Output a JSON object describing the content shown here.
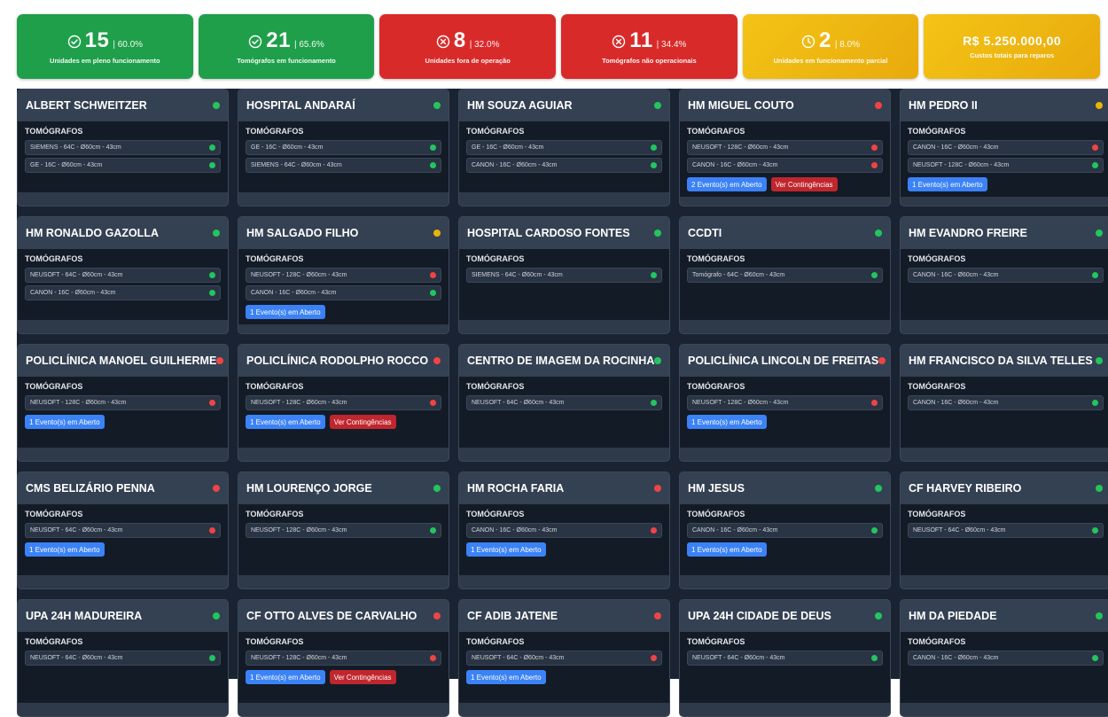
{
  "stats": [
    {
      "icon": "check-circle-icon",
      "value": "15",
      "pct": "| 60.0%",
      "label": "Unidades em pleno funcionamento",
      "color": "green"
    },
    {
      "icon": "check-circle-icon",
      "value": "21",
      "pct": "| 65.6%",
      "label": "Tomógrafos em funcionamento",
      "color": "green"
    },
    {
      "icon": "x-circle-icon",
      "value": "8",
      "pct": "| 32.0%",
      "label": "Unidades fora de operação",
      "color": "red"
    },
    {
      "icon": "x-circle-icon",
      "value": "11",
      "pct": "| 34.4%",
      "label": "Tomógrafos não operacionais",
      "color": "red"
    },
    {
      "icon": "clock-icon",
      "value": "2",
      "pct": "| 8.0%",
      "label": "Unidades em funcionamento parcial",
      "color": "yellow"
    },
    {
      "icon": "",
      "value": "R$ 5.250.000,00",
      "pct": "",
      "label": "Custos totais para reparos",
      "color": "yellow"
    }
  ],
  "section_label": "TOMÓGRAFOS",
  "status_colors": {
    "green": "#22c55e",
    "red": "#ef4444",
    "yellow": "#eab308"
  },
  "units": [
    {
      "name": "ALBERT SCHWEITZER",
      "status": "green",
      "devices": [
        {
          "name": "SIEMENS - 64C - Ø60cm - 43cm",
          "status": "green"
        },
        {
          "name": "GE - 16C - Ø60cm - 43cm",
          "status": "green"
        }
      ],
      "buttons": []
    },
    {
      "name": "HOSPITAL ANDARAÍ",
      "status": "green",
      "devices": [
        {
          "name": "GE - 16C - Ø60cm - 43cm",
          "status": "green"
        },
        {
          "name": "SIEMENS - 64C - Ø60cm - 43cm",
          "status": "green"
        }
      ],
      "buttons": []
    },
    {
      "name": "HM SOUZA AGUIAR",
      "status": "green",
      "devices": [
        {
          "name": "GE - 16C - Ø60cm - 43cm",
          "status": "green"
        },
        {
          "name": "CANON - 16C - Ø60cm - 43cm",
          "status": "green"
        }
      ],
      "buttons": []
    },
    {
      "name": "HM MIGUEL COUTO",
      "status": "red",
      "devices": [
        {
          "name": "NEUSOFT - 128C - Ø60cm - 43cm",
          "status": "red"
        },
        {
          "name": "CANON - 16C - Ø60cm - 43cm",
          "status": "red"
        }
      ],
      "buttons": [
        {
          "label": "2 Evento(s) em Aberto",
          "kind": "blue"
        },
        {
          "label": "Ver Contingências",
          "kind": "red"
        }
      ]
    },
    {
      "name": "HM PEDRO II",
      "status": "yellow",
      "devices": [
        {
          "name": "CANON - 16C - Ø60cm - 43cm",
          "status": "red"
        },
        {
          "name": "NEUSOFT - 128C - Ø60cm - 43cm",
          "status": "green"
        }
      ],
      "buttons": [
        {
          "label": "1 Evento(s) em Aberto",
          "kind": "blue"
        }
      ]
    },
    {
      "name": "HM RONALDO GAZOLLA",
      "status": "green",
      "devices": [
        {
          "name": "NEUSOFT - 64C - Ø60cm - 43cm",
          "status": "green"
        },
        {
          "name": "CANON - 16C - Ø60cm - 43cm",
          "status": "green"
        }
      ],
      "buttons": []
    },
    {
      "name": "HM SALGADO FILHO",
      "status": "yellow",
      "devices": [
        {
          "name": "NEUSOFT - 128C - Ø60cm - 43cm",
          "status": "red"
        },
        {
          "name": "CANON - 16C - Ø60cm - 43cm",
          "status": "green"
        }
      ],
      "buttons": [
        {
          "label": "1 Evento(s) em Aberto",
          "kind": "blue"
        }
      ]
    },
    {
      "name": "HOSPITAL CARDOSO FONTES",
      "status": "green",
      "devices": [
        {
          "name": "SIEMENS - 64C - Ø60cm - 43cm",
          "status": "green"
        }
      ],
      "buttons": []
    },
    {
      "name": "CCDTI",
      "status": "green",
      "devices": [
        {
          "name": "Tomógrafo - 64C - Ø60cm - 43cm",
          "status": "green"
        }
      ],
      "buttons": []
    },
    {
      "name": "HM EVANDRO FREIRE",
      "status": "green",
      "devices": [
        {
          "name": "CANON - 16C - Ø60cm - 43cm",
          "status": "green"
        }
      ],
      "buttons": []
    },
    {
      "name": "POLICLÍNICA MANOEL GUILHERME",
      "status": "red",
      "devices": [
        {
          "name": "NEUSOFT - 128C - Ø60cm - 43cm",
          "status": "red"
        }
      ],
      "buttons": [
        {
          "label": "1 Evento(s) em Aberto",
          "kind": "blue"
        }
      ]
    },
    {
      "name": "POLICLÍNICA RODOLPHO ROCCO",
      "status": "red",
      "devices": [
        {
          "name": "NEUSOFT - 128C - Ø60cm - 43cm",
          "status": "red"
        }
      ],
      "buttons": [
        {
          "label": "1 Evento(s) em Aberto",
          "kind": "blue"
        },
        {
          "label": "Ver Contingências",
          "kind": "red"
        }
      ]
    },
    {
      "name": "CENTRO DE IMAGEM DA ROCINHA",
      "status": "green",
      "devices": [
        {
          "name": "NEUSOFT - 64C - Ø60cm - 43cm",
          "status": "green"
        }
      ],
      "buttons": []
    },
    {
      "name": "POLICLÍNICA LINCOLN DE FREITAS",
      "status": "red",
      "devices": [
        {
          "name": "NEUSOFT - 128C - Ø60cm - 43cm",
          "status": "red"
        }
      ],
      "buttons": [
        {
          "label": "1 Evento(s) em Aberto",
          "kind": "blue"
        }
      ]
    },
    {
      "name": "HM FRANCISCO DA SILVA TELLES",
      "status": "green",
      "devices": [
        {
          "name": "CANON - 16C - Ø60cm - 43cm",
          "status": "green"
        }
      ],
      "buttons": []
    },
    {
      "name": "CMS BELIZÁRIO PENNA",
      "status": "red",
      "devices": [
        {
          "name": "NEUSOFT - 64C - Ø60cm - 43cm",
          "status": "red"
        }
      ],
      "buttons": [
        {
          "label": "1 Evento(s) em Aberto",
          "kind": "blue"
        }
      ]
    },
    {
      "name": "HM LOURENÇO JORGE",
      "status": "green",
      "devices": [
        {
          "name": "NEUSOFT - 128C - Ø60cm - 43cm",
          "status": "green"
        }
      ],
      "buttons": []
    },
    {
      "name": "HM ROCHA FARIA",
      "status": "red",
      "devices": [
        {
          "name": "CANON - 16C - Ø60cm - 43cm",
          "status": "red"
        }
      ],
      "buttons": [
        {
          "label": "1 Evento(s) em Aberto",
          "kind": "blue"
        }
      ]
    },
    {
      "name": "HM JESUS",
      "status": "green",
      "devices": [
        {
          "name": "CANON - 16C - Ø60cm - 43cm",
          "status": "green"
        }
      ],
      "buttons": [
        {
          "label": "1 Evento(s) em Aberto",
          "kind": "blue"
        }
      ]
    },
    {
      "name": "CF HARVEY RIBEIRO",
      "status": "green",
      "devices": [
        {
          "name": "NEUSOFT - 64C - Ø60cm - 43cm",
          "status": "green"
        }
      ],
      "buttons": []
    },
    {
      "name": "UPA 24H MADUREIRA",
      "status": "green",
      "devices": [
        {
          "name": "NEUSOFT - 64C - Ø60cm - 43cm",
          "status": "green"
        }
      ],
      "buttons": []
    },
    {
      "name": "CF OTTO ALVES DE CARVALHO",
      "status": "red",
      "devices": [
        {
          "name": "NEUSOFT - 128C - Ø60cm - 43cm",
          "status": "red"
        }
      ],
      "buttons": [
        {
          "label": "1 Evento(s) em Aberto",
          "kind": "blue"
        },
        {
          "label": "Ver Contingências",
          "kind": "red"
        }
      ]
    },
    {
      "name": "CF ADIB JATENE",
      "status": "red",
      "devices": [
        {
          "name": "NEUSOFT - 64C - Ø60cm - 43cm",
          "status": "red"
        }
      ],
      "buttons": [
        {
          "label": "1 Evento(s) em Aberto",
          "kind": "blue"
        }
      ]
    },
    {
      "name": "UPA 24H CIDADE DE DEUS",
      "status": "green",
      "devices": [
        {
          "name": "NEUSOFT - 64C - Ø60cm - 43cm",
          "status": "green"
        }
      ],
      "buttons": []
    },
    {
      "name": "HM DA PIEDADE",
      "status": "green",
      "devices": [
        {
          "name": "CANON - 16C - Ø60cm - 43cm",
          "status": "green"
        }
      ],
      "buttons": []
    }
  ]
}
